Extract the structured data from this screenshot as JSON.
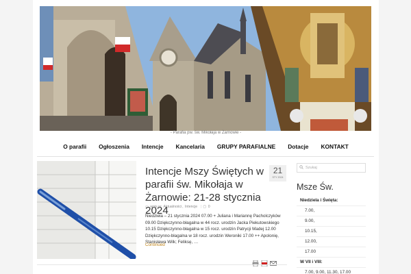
{
  "header": {
    "caption": "- Parafia pw. św. Mikołaja w Żarnowie -"
  },
  "nav": {
    "items": [
      "O parafii",
      "Ogłoszenia",
      "Intencje",
      "Kancelaria",
      "GRUPY PARAFIALNE",
      "Dotacje",
      "KONTAKT"
    ]
  },
  "post": {
    "title": "Intencje Mszy Świętych w parafii św. Mikołaja w Żarnowie: 21-28 stycznia 2024",
    "date_day": "21",
    "date_month": "STY 2024",
    "meta_prefix": "wpis w:",
    "category_1": "Aktualności",
    "category_2": "Intencje",
    "comments": "0",
    "excerpt": "Niedziela – 21 stycznia 2024 07.00 + Juliana i Mariannę Pacholczyków 09.00 Dziękczynno-błagalna w 44 rocz. urodzin Jacka Piekutowskiego 10.15 Dziękczynno-błagalna w 15 rocz. urodzin Patrycji Madej 12.00 Dziękczynno-błagalna w 18 rocz. urodzin Weroniki 17.00 ++ Apolonię, Stanisława Wilk; Feliksę, …",
    "continued": "Continued"
  },
  "sidebar": {
    "search_placeholder": "Szukaj",
    "widget_title": "Msze Św.",
    "sunday_header": "Niedziela i Święta:",
    "sunday_times": [
      "7.00,",
      "9.00,",
      "10.15,",
      "12.00,",
      "17.00"
    ],
    "weekday_header": "W VII i VIII:",
    "weekday_times": [
      "7.00, 9.00, 11.30, 17.00"
    ]
  },
  "colors": {
    "accent": "#c0841a",
    "text": "#333333"
  },
  "icons": [
    "search-icon",
    "folder-icon",
    "comment-icon",
    "print-icon",
    "pdf-icon",
    "email-icon"
  ]
}
